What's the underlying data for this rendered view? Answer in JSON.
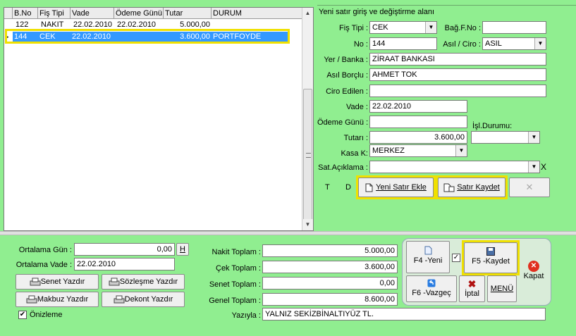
{
  "grid": {
    "columns": [
      "B.No",
      "Fiş Tipi",
      "Vade",
      "Ödeme Günü",
      "Tutar",
      "DURUM"
    ],
    "rows": [
      {
        "bno": "122",
        "tip": "NAKIT",
        "vade": "22.02.2010",
        "odeme": "22.02.2010",
        "tutar": "5.000,00",
        "durum": ""
      },
      {
        "bno": "144",
        "tip": "CEK",
        "vade": "22.02.2010",
        "odeme": "",
        "tutar": "3.600,00",
        "durum": "PORTFOYDE"
      }
    ]
  },
  "form": {
    "group_title": "Yeni satır giriş ve değiştirme alanı",
    "fis_tipi_label": "Fiş Tipi :",
    "fis_tipi_value": "CEK",
    "bag_fno_label": "Bağ.F.No :",
    "bag_fno_value": "",
    "no_label": "No :",
    "no_value": "144",
    "asil_ciro_label": "Asıl / Ciro :",
    "asil_ciro_value": "ASIL",
    "yer_banka_label": "Yer / Banka :",
    "yer_banka_value": "ZİRAAT BANKASI",
    "asil_borclu_label": "Asıl Borçlu :",
    "asil_borclu_value": "AHMET TOK",
    "ciro_edilen_label": "Ciro Edilen :",
    "ciro_edilen_value": "",
    "vade_label": "Vade :",
    "vade_value": "22.02.2010",
    "odeme_gunu_label": "Ödeme Günü :",
    "odeme_gunu_value": "",
    "isl_durumu_label": "İşl.Durumu:",
    "isl_durumu_value": "",
    "tutar_label": "Tutarı :",
    "tutar_value": "3.600,00",
    "kasa_label": "Kasa K:",
    "kasa_value": "MERKEZ",
    "sat_aciklama_label": "Sat.Açıklama :",
    "sat_aciklama_value": "",
    "x_label": "X",
    "t_label": "T",
    "d_label": "D",
    "yeni_satir_label": "Yeni Satır Ekle",
    "satir_kaydet_label": "Satır Kaydet"
  },
  "summary": {
    "ortalama_gun_label": "Ortalama Gün :",
    "ortalama_gun_value": "0,00",
    "h_label": "H",
    "ortalama_vade_label": "Ortalama Vade :",
    "ortalama_vade_value": "22.02.2010",
    "senet_yazdir": "Senet Yazdır",
    "sozlesme_yazdir": "Sözleşme Yazdır",
    "makbuz_yazdir": "Makbuz Yazdır",
    "dekont_yazdir": "Dekont Yazdır",
    "onizleme_label": "Önizleme",
    "onizleme_mark": "✔",
    "nakit_toplam_label": "Nakit Toplam :",
    "nakit_toplam_value": "5.000,00",
    "cek_toplam_label": "Çek Toplam :",
    "cek_toplam_value": "3.600,00",
    "senet_toplam_label": "Senet Toplam :",
    "senet_toplam_value": "0,00",
    "genel_toplam_label": "Genel Toplam :",
    "genel_toplam_value": "8.600,00",
    "yaziyla_label": "Yazıyla :",
    "yaziyla_value": "YALNIZ SEKİZBİNALTIYÜZ TL."
  },
  "actions": {
    "f4_yeni": "F4 -Yeni",
    "f5_kaydet": "F5 -Kaydet",
    "f6_vazgec": "F6 -Vazgeç",
    "iptal": "İptal",
    "menu": "MENÜ",
    "kapat": "Kapat"
  },
  "colors": {
    "background": "#90ee90",
    "selection": "#3399ff",
    "highlight": "#f0e000",
    "close_red": "#e03020"
  }
}
